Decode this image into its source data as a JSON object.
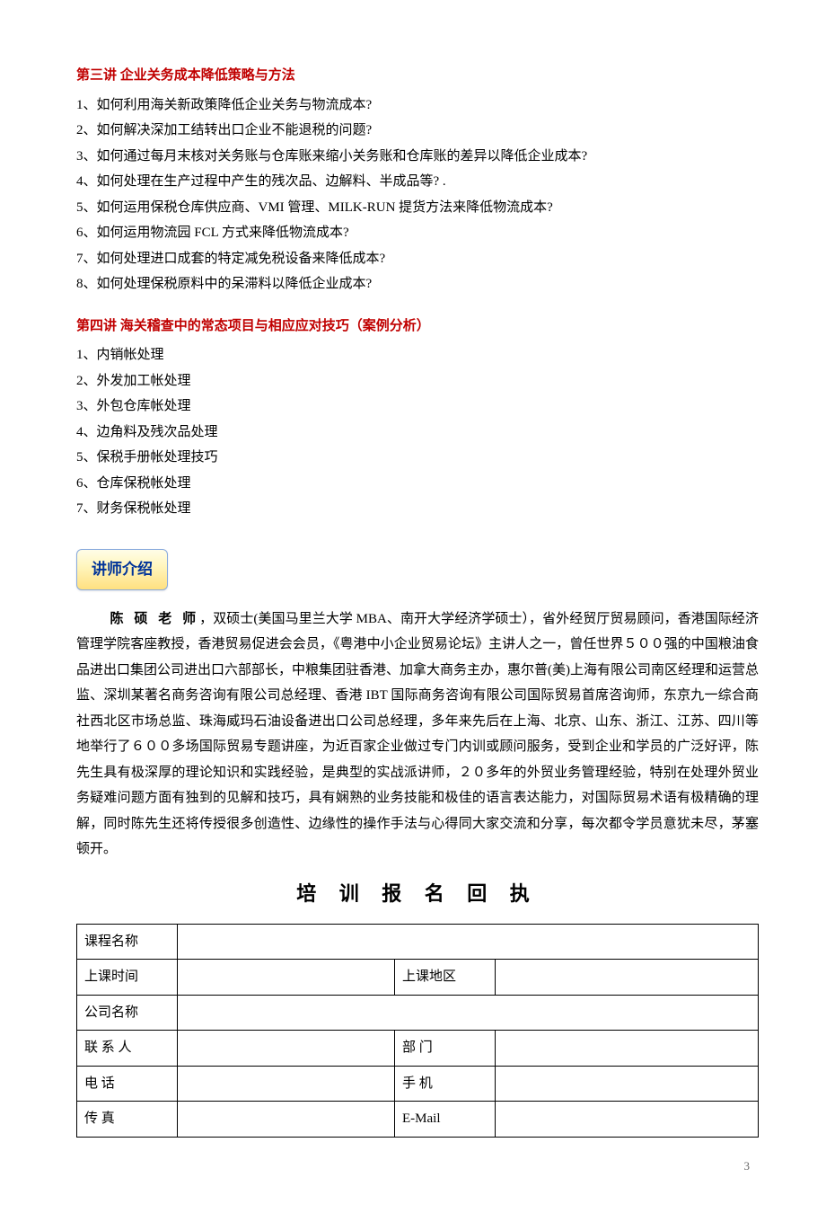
{
  "section3": {
    "title": "第三讲  企业关务成本降低策略与方法",
    "items": [
      "1、如何利用海关新政策降低企业关务与物流成本?",
      "2、如何解决深加工结转出口企业不能退税的问题?",
      "3、如何通过每月末核对关务账与仓库账来缩小关务账和仓库账的差异以降低企业成本?",
      "4、如何处理在生产过程中产生的残次品、边解料、半成品等? .",
      "5、如何运用保税仓库供应商、VMI 管理、MILK-RUN 提货方法来降低物流成本?",
      "6、如何运用物流园 FCL 方式来降低物流成本?",
      "7、如何处理进口成套的特定减免税设备来降低成本?",
      "8、如何处理保税原料中的呆滞料以降低企业成本?"
    ]
  },
  "section4": {
    "title": "第四讲  海关稽查中的常态项目与相应应对技巧（案例分析）",
    "items": [
      "1、内销帐处理",
      "2、外发加工帐处理",
      "3、外包仓库帐处理",
      "4、边角料及残次品处理",
      "5、保税手册帐处理技巧",
      "6、仓库保税帐处理",
      "7、财务保税帐处理"
    ]
  },
  "instructor": {
    "badge": "讲师介绍",
    "name": "陈 硕 老 师",
    "bio_rest": "，双硕士(美国马里兰大学 MBA、南开大学经济学硕士），省外经贸厅贸易顾问，香港国际经济管理学院客座教授，香港贸易促进会会员，《粤港中小企业贸易论坛》主讲人之一，曾任世界５００强的中国粮油食品进出口集团公司进出口六部部长，中粮集团驻香港、加拿大商务主办，惠尔普(美)上海有限公司南区经理和运营总监、深圳某著名商务咨询有限公司总经理、香港 IBT 国际商务咨询有限公司国际贸易首席咨询师，东京九一综合商社西北区市场总监、珠海威玛石油设备进出口公司总经理，多年来先后在上海、北京、山东、浙江、江苏、四川等地举行了６００多场国际贸易专题讲座，为近百家企业做过专门内训或顾问服务，受到企业和学员的广泛好评，陈先生具有极深厚的理论知识和实践经验，是典型的实战派讲师，２０多年的外贸业务管理经验，特别在处理外贸业务疑难问题方面有独到的见解和技巧，具有娴熟的业务技能和极佳的语言表达能力，对国际贸易术语有极精确的理解，同时陈先生还将传授很多创造性、边缘性的操作手法与心得同大家交流和分享，每次都令学员意犹未尽，茅塞顿开。"
  },
  "form": {
    "title": "培 训 报 名 回 执",
    "labels": {
      "course": "课程名称",
      "time": "上课时间",
      "region": "上课地区",
      "company": "公司名称",
      "contact": "联 系 人",
      "dept": "部    门",
      "phone": "电    话",
      "mobile": "手    机",
      "fax": "传    真",
      "email": "E-Mail"
    }
  },
  "page_number": "3"
}
